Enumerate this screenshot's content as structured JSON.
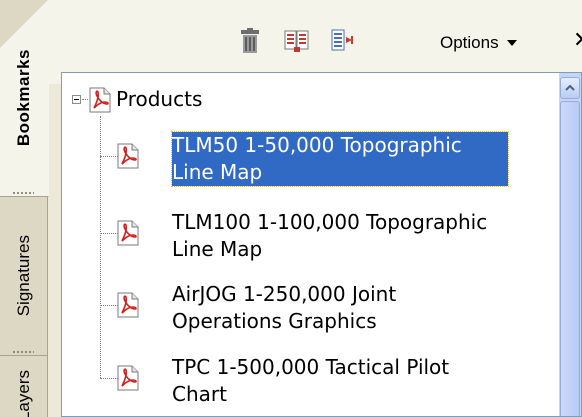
{
  "tabs": [
    {
      "label": "Bookmarks",
      "active": true
    },
    {
      "label": "Signatures",
      "active": false
    },
    {
      "label": "Layers",
      "active": false
    }
  ],
  "toolbar": {
    "options_label": "Options",
    "icons": [
      "trash-icon",
      "bookmark-from-page-icon",
      "expand-bookmark-icon",
      "chevron-down-icon",
      "close-icon"
    ]
  },
  "tree": {
    "root": {
      "label": "Products",
      "expanded": true
    },
    "items": [
      {
        "line1": "TLM50 1-50,000 Topographic",
        "line2": "Line Map",
        "selected": true
      },
      {
        "line1": "TLM100 1-100,000 Topographic",
        "line2": "Line Map",
        "selected": false
      },
      {
        "line1": "AirJOG 1-250,000 Joint",
        "line2": "Operations Graphics",
        "selected": false
      },
      {
        "line1": "TPC 1-500,000 Tactical Pilot",
        "line2": "Chart",
        "selected": false
      }
    ]
  },
  "colors": {
    "selection": "#316ac5",
    "pdf_red": "#d0201c",
    "scrollbar": "#c7d5f5"
  }
}
